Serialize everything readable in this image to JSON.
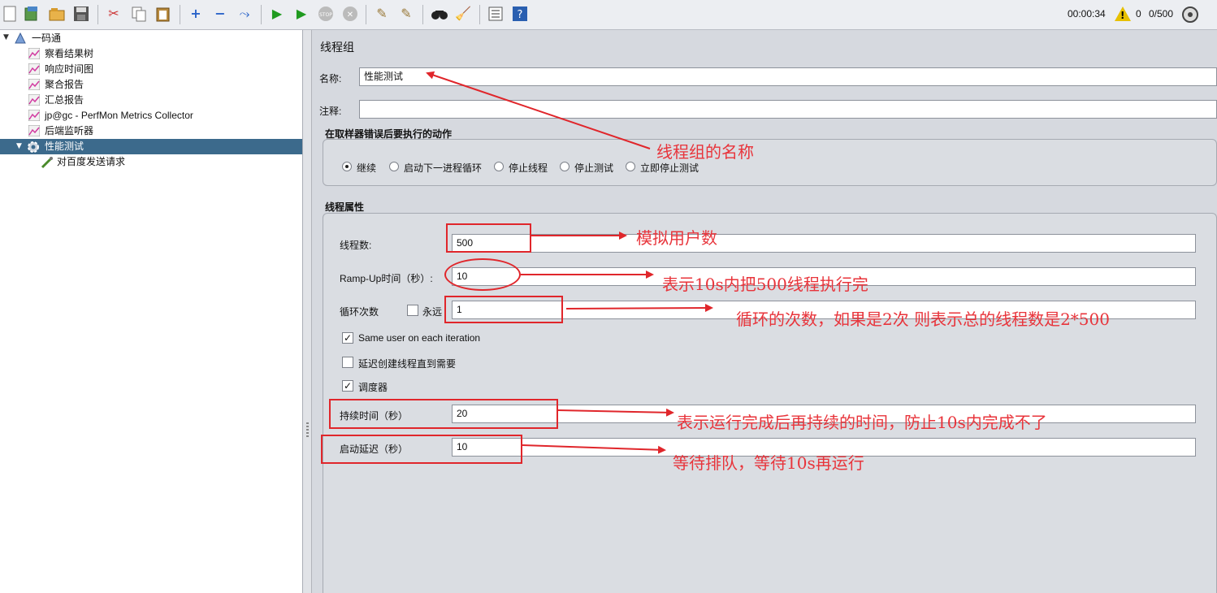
{
  "toolbar": {
    "icons": [
      "new-icon",
      "templates-icon",
      "open-icon",
      "save-icon",
      "cut-icon",
      "copy-icon",
      "paste-icon",
      "expand-icon",
      "collapse-icon",
      "toggle-icon",
      "start-icon",
      "start-no-pause-icon",
      "stop-icon",
      "shutdown-icon",
      "clear-icon",
      "clear-all-icon",
      "search-icon",
      "reset-search-icon",
      "function-helper-icon",
      "help-icon"
    ],
    "timer": "00:00:34",
    "warning_count": "0",
    "threads": "0/500"
  },
  "tree": {
    "root": "一码通",
    "items": [
      "察看结果树",
      "响应时间图",
      "聚合报告",
      "汇总报告",
      "jp@gc - PerfMon Metrics Collector",
      "后端监听器"
    ],
    "selected": "性能测试",
    "child": "对百度发送请求"
  },
  "panel": {
    "title": "线程组",
    "name_label": "名称:",
    "name_value": "性能测试",
    "comment_label": "注释:",
    "comment_value": "",
    "error_group_title": "在取样器错误后要执行的动作",
    "error_options": [
      "继续",
      "启动下一进程循环",
      "停止线程",
      "停止测试",
      "立即停止测试"
    ],
    "selected_error_option": "继续",
    "props_title": "线程属性",
    "threads_label": "线程数:",
    "threads_value": "500",
    "rampup_label": "Ramp-Up时间（秒）:",
    "rampup_value": "10",
    "loop_label": "循环次数",
    "forever_label": "永远",
    "loop_value": "1",
    "same_user_label": "Same user on each iteration",
    "delay_create_label": "延迟创建线程直到需要",
    "scheduler_label": "调度器",
    "duration_label": "持续时间（秒）",
    "duration_value": "20",
    "startup_delay_label": "启动延迟（秒）",
    "startup_delay_value": "10"
  },
  "annotations": {
    "name": "线程组的名称",
    "threads": "模拟用户数",
    "rampup": "表示10s内把500线程执行完",
    "loop": "循环的次数，如果是2次 则表示总的线程数是2*500",
    "duration": "表示运行完成后再持续的时间，防止10s内完成不了",
    "delay": "等待排队，等待10s再运行"
  },
  "colors": {
    "annotation_red": "#e0262b",
    "selection": "#3c6a8c"
  }
}
